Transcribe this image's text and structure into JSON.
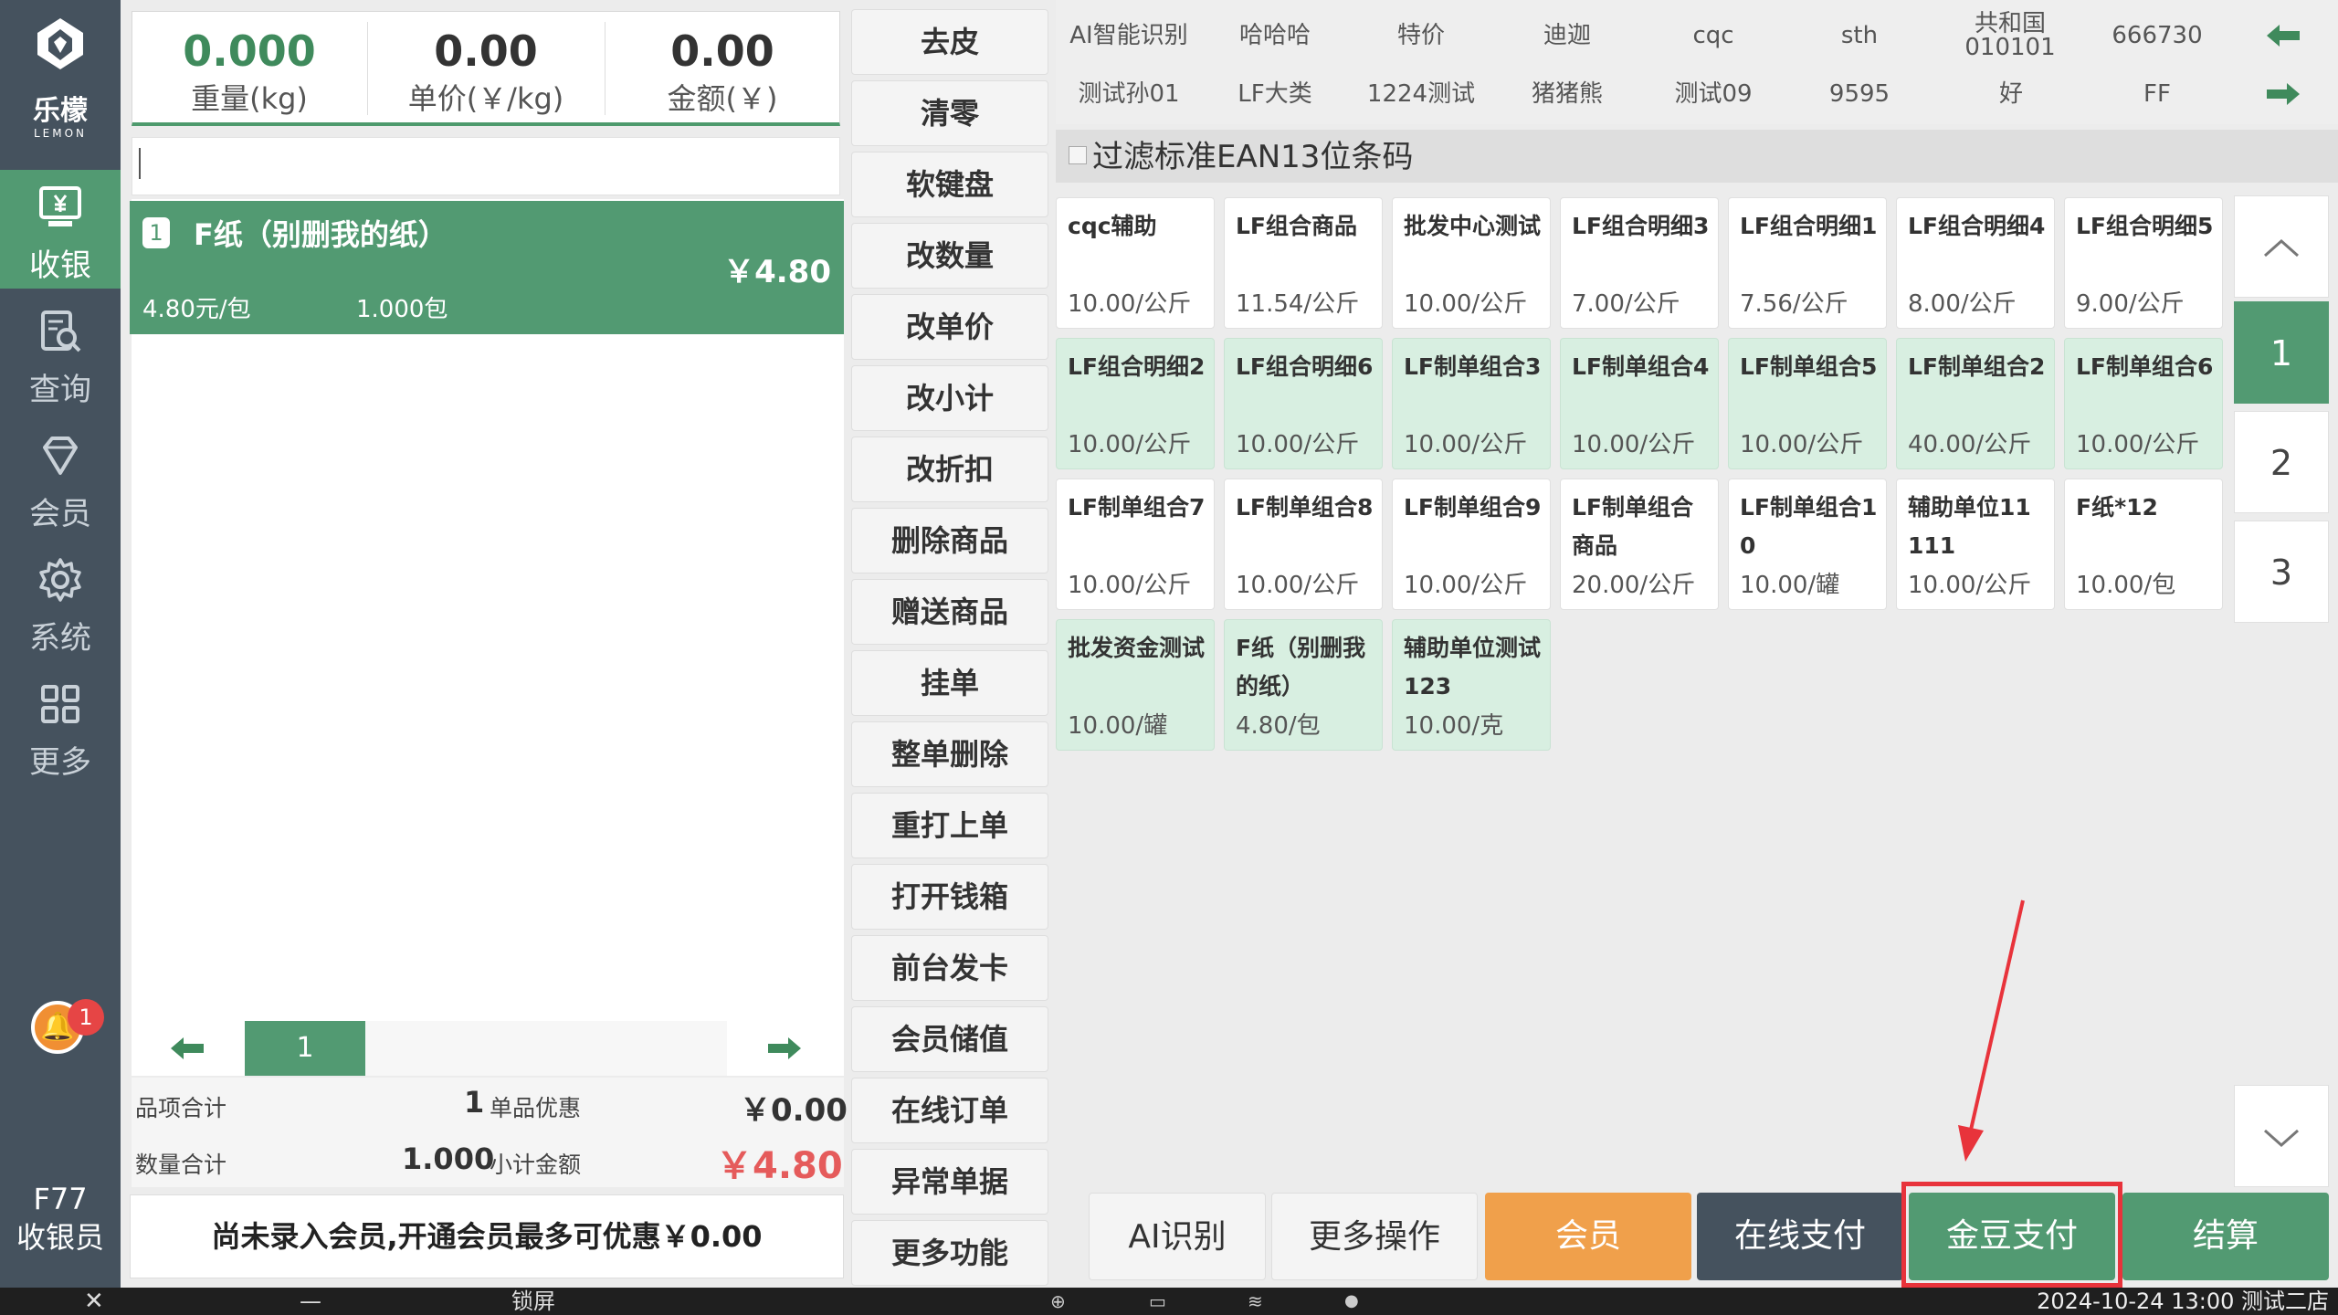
{
  "app": {
    "brand_cn": "乐檬",
    "brand_en": "LEMON",
    "logo_icon": "lemon-logo-icon"
  },
  "sidebar": {
    "items": [
      {
        "label": "收银",
        "icon": "cashier-icon",
        "active": true
      },
      {
        "label": "查询",
        "icon": "search-doc-icon",
        "active": false
      },
      {
        "label": "会员",
        "icon": "diamond-icon",
        "active": false
      },
      {
        "label": "系统",
        "icon": "gear-icon",
        "active": false
      },
      {
        "label": "更多",
        "icon": "grid-icon",
        "active": false
      }
    ],
    "notification_count": "1",
    "operator_key": "F77",
    "operator_role": "收银员"
  },
  "scale": {
    "weight_value": "0.000",
    "weight_label": "重量(kg)",
    "unit_price_value": "0.00",
    "unit_price_label": "单价(￥/kg)",
    "amount_value": "0.00",
    "amount_label": "金额(￥)"
  },
  "cart": {
    "items": [
      {
        "index": "1",
        "name": "F纸（别删我的纸）",
        "total": "￥4.80",
        "unit_price": "4.80元/包",
        "qty": "1.000包"
      }
    ],
    "page": "1"
  },
  "summary": {
    "item_count_label": "品项合计",
    "item_count": "1",
    "discount_label": "单品优惠",
    "discount": "￥0.00",
    "qty_total_label": "数量合计",
    "qty_total": "1.000",
    "subtotal_label": "小计金额",
    "subtotal": "￥4.80"
  },
  "member_banner": "尚未录入会员,开通会员最多可优惠￥0.00",
  "functions": [
    "去皮",
    "清零",
    "软键盘",
    "改数量",
    "改单价",
    "改小计",
    "改折扣",
    "删除商品",
    "赠送商品",
    "挂单",
    "整单删除",
    "重打上单",
    "打开钱箱",
    "前台发卡",
    "会员储值",
    "在线订单",
    "异常单据",
    "更多功能"
  ],
  "categories": {
    "row1": [
      "AI智能识别",
      "哈哈哈",
      "特价",
      "迪迦",
      "cqc",
      "sth",
      "共和国010101",
      "666730"
    ],
    "row2": [
      "测试孙01",
      "LF大类",
      "1224测试",
      "猪猪熊",
      "测试09",
      "9595",
      "好",
      "FF"
    ]
  },
  "filter": {
    "label": "过滤标准EAN13位条码",
    "checked": false
  },
  "products": [
    {
      "name": "cqc辅助",
      "price": "10.00/公斤",
      "highlight": false
    },
    {
      "name": "LF组合商品",
      "price": "11.54/公斤",
      "highlight": false
    },
    {
      "name": "批发中心测试",
      "price": "10.00/公斤",
      "highlight": false
    },
    {
      "name": "LF组合明细3",
      "price": "7.00/公斤",
      "highlight": false
    },
    {
      "name": "LF组合明细1",
      "price": "7.56/公斤",
      "highlight": false
    },
    {
      "name": "LF组合明细4",
      "price": "8.00/公斤",
      "highlight": false
    },
    {
      "name": "LF组合明细5",
      "price": "9.00/公斤",
      "highlight": false
    },
    {
      "name": "LF组合明细2",
      "price": "10.00/公斤",
      "highlight": true
    },
    {
      "name": "LF组合明细6",
      "price": "10.00/公斤",
      "highlight": true
    },
    {
      "name": "LF制单组合3",
      "price": "10.00/公斤",
      "highlight": true
    },
    {
      "name": "LF制单组合4",
      "price": "10.00/公斤",
      "highlight": true
    },
    {
      "name": "LF制单组合5",
      "price": "10.00/公斤",
      "highlight": true
    },
    {
      "name": "LF制单组合2",
      "price": "40.00/公斤",
      "highlight": true
    },
    {
      "name": "LF制单组合6",
      "price": "10.00/公斤",
      "highlight": true
    },
    {
      "name": "LF制单组合7",
      "price": "10.00/公斤",
      "highlight": false
    },
    {
      "name": "LF制单组合8",
      "price": "10.00/公斤",
      "highlight": false
    },
    {
      "name": "LF制单组合9",
      "price": "10.00/公斤",
      "highlight": false
    },
    {
      "name": "LF制单组合商品",
      "price": "20.00/公斤",
      "highlight": false
    },
    {
      "name": "LF制单组合10",
      "price": "10.00/罐",
      "highlight": false
    },
    {
      "name": "辅助单位11111",
      "price": "10.00/公斤",
      "highlight": false
    },
    {
      "name": "F纸*12",
      "price": "10.00/包",
      "highlight": false
    },
    {
      "name": "批发资金测试",
      "price": "10.00/罐",
      "highlight": true
    },
    {
      "name": "F纸（别删我的纸）",
      "price": "4.80/包",
      "highlight": true
    },
    {
      "name": "辅助单位测试123",
      "price": "10.00/克",
      "highlight": true
    }
  ],
  "product_pages": [
    "1",
    "2",
    "3"
  ],
  "actions": {
    "ai": "AI识别",
    "more_ops": "更多操作",
    "member": "会员",
    "online_pay": "在线支付",
    "golden_bean": "金豆支付",
    "checkout": "结算"
  },
  "colors": {
    "primary_green": "#529a72",
    "light_green": "#d8efe1",
    "sidebar": "#45525e",
    "member_orange": "#f0a04b",
    "online_dark": "#45525e",
    "annotation_red": "#e8333b",
    "subtotal_red": "#e55b5b"
  },
  "statusbar": {
    "lock_label": "锁屏",
    "datetime_store": "2024-10-24 13:00 测试二店"
  }
}
